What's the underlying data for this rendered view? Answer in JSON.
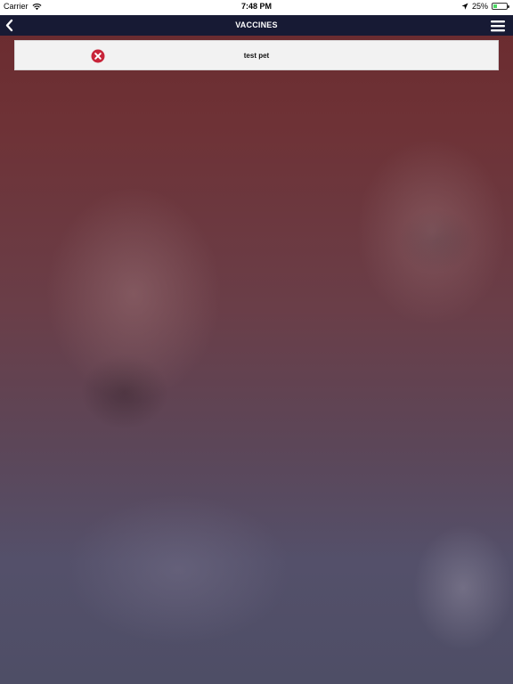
{
  "status_bar": {
    "carrier": "Carrier",
    "time": "7:48 PM",
    "battery": "25%",
    "icons": [
      "wifi-icon",
      "location-icon",
      "battery-icon"
    ]
  },
  "nav": {
    "title": "VACCINES",
    "back_icon": "chevron-left-icon",
    "menu_icon": "hamburger-menu-icon"
  },
  "pets": [
    {
      "name": "test pet",
      "delete_icon": "delete-x-circle-icon"
    }
  ],
  "colors": {
    "nav_background": "#171a34",
    "delete_red": "#c8253a",
    "row_background": "#f2f2f2"
  }
}
